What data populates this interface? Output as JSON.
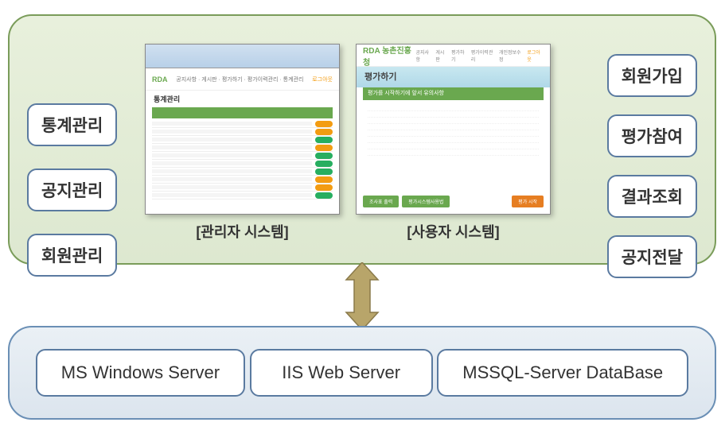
{
  "leftLabels": [
    "통계관리",
    "공지관리",
    "회원관리"
  ],
  "rightLabels": [
    "회원가입",
    "평가참여",
    "결과조회",
    "공지전달"
  ],
  "captions": {
    "admin": "[관리자 시스템]",
    "user": "[사용자 시스템]"
  },
  "servers": [
    "MS Windows Server",
    "IIS Web Server",
    "MSSQL-Server DataBase"
  ],
  "adminScreenshot": {
    "logo": "RDA",
    "navLinks": "공지사항 · 게시판 · 평가하기 · 평가이력관리 · 통계관리",
    "logout": "로그아웃",
    "section": "통계관리"
  },
  "userScreenshot": {
    "logo": "RDA 농촌진흥청",
    "nav": [
      "공지사항",
      "게시판",
      "평가하기",
      "평가이력관리",
      "개인정보수정",
      "로그아웃"
    ],
    "banner": "평가하기",
    "greenHeader": "평가를 시작하기에 앞서 유의사항",
    "btnLeft": "조사표 출력",
    "btnMid": "평가시스템사용법",
    "btnRight": "평가 시작"
  }
}
